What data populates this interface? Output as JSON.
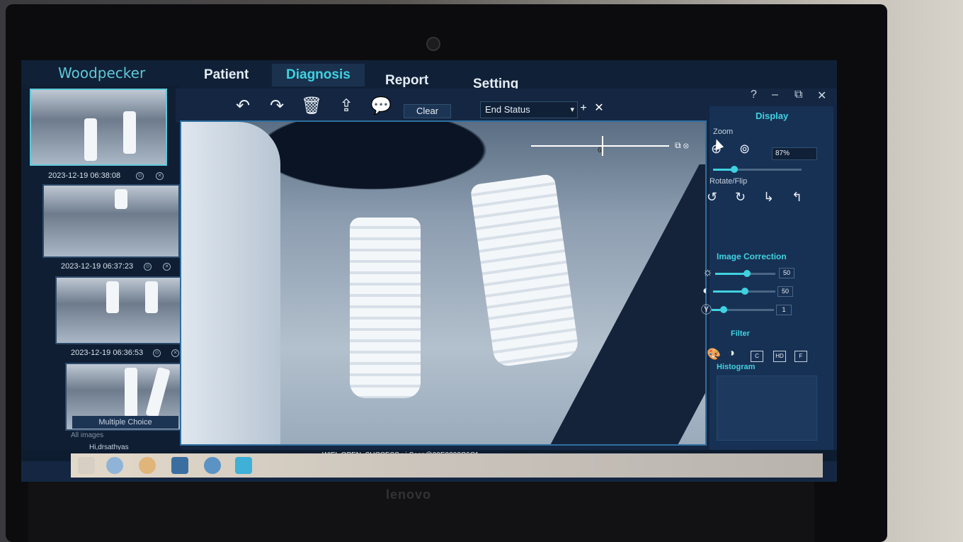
{
  "app": {
    "brand": "Woodpecker",
    "tabs": [
      {
        "label": "Patient"
      },
      {
        "label": "Diagnosis"
      },
      {
        "label": "Report"
      },
      {
        "label": "Setting"
      }
    ],
    "window_controls": [
      "help-icon",
      "minimize-icon",
      "restore-icon",
      "close-icon"
    ]
  },
  "thumbnails": [
    {
      "date": "2023-12-19 06:38:08",
      "selected": true,
      "measure": "6"
    },
    {
      "date": "2023-12-19 06:37:23",
      "selected": false,
      "measure": "6"
    },
    {
      "date": "2023-12-19 06:36:53",
      "selected": false
    },
    {
      "date": "",
      "selected": false
    }
  ],
  "sidebar": {
    "multiple_choice": "Multiple Choice",
    "all_images": "All images",
    "greeting": "Hi,drsathyas"
  },
  "toolbar": {
    "icons": [
      "undo-icon",
      "redo-icon",
      "delete-icon",
      "export-icon",
      "comment-icon"
    ],
    "clear_label": "Clear",
    "status_select": "End Status"
  },
  "viewer": {
    "measure_label": "6"
  },
  "display_panel": {
    "title": "Display",
    "zoom_label": "Zoom",
    "zoom_value": "87%",
    "rotate_label": "Rotate/Flip",
    "correction_title": "Image Correction",
    "brightness": "50",
    "contrast": "50",
    "gamma": "1",
    "filter_title": "Filter",
    "filters": [
      "C",
      "HD",
      "F"
    ],
    "histogram_title": "Histogram"
  },
  "status_bar": {
    "text": "WIFI_OPEN_SUCCESS : i-Scan@00E0202C6C1"
  },
  "laptop_brand": "lenovo",
  "colors": {
    "accent": "#3fd2e0",
    "panel": "#173154",
    "background": "#142641"
  }
}
